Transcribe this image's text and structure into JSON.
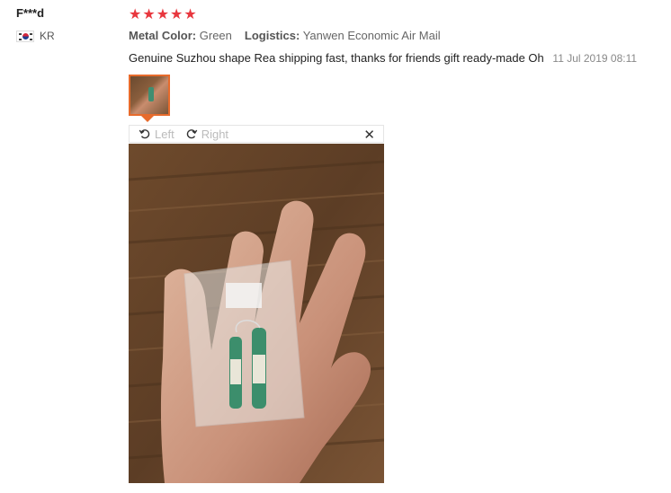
{
  "user": {
    "name": "F***d",
    "country": "KR"
  },
  "rating": {
    "stars": 5
  },
  "attributes": [
    {
      "label": "Metal Color:",
      "value": "Green"
    },
    {
      "label": "Logistics:",
      "value": "Yanwen Economic Air Mail"
    }
  ],
  "review": {
    "text": "Genuine Suzhou shape Rea shipping fast, thanks for friends gift ready-made Oh",
    "date": "11 Jul 2019 08:11"
  },
  "viewer": {
    "rotate_left_label": "Left",
    "rotate_right_label": "Right"
  },
  "colors": {
    "star": "#e8373e",
    "thumb_border": "#e76b2c"
  }
}
